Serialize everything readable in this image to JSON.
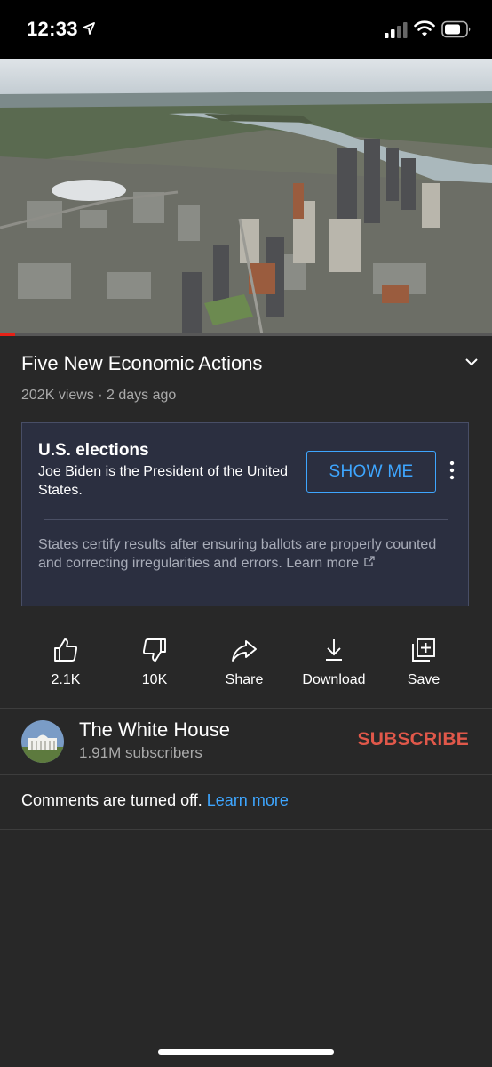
{
  "status_bar": {
    "time": "12:33",
    "icons": [
      "location-arrow-icon",
      "cellular-signal-icon",
      "wifi-icon",
      "battery-icon"
    ]
  },
  "video": {
    "thumbnail": "aerial-city-river-image",
    "progress_fraction": 0.03,
    "progress_color": "#e62117"
  },
  "details": {
    "title": "Five New Economic Actions",
    "meta": "202K views · 2 days ago"
  },
  "info_panel": {
    "heading": "U.S. elections",
    "text": "Joe Biden is the President of the United States.",
    "button_label": "SHOW ME",
    "footnote": "States certify results after ensuring ballots are properly counted and correcting irregularities and errors. Learn more"
  },
  "actions": [
    {
      "icon": "thumbs-up-icon",
      "label": "2.1K"
    },
    {
      "icon": "thumbs-down-icon",
      "label": "10K"
    },
    {
      "icon": "share-icon",
      "label": "Share"
    },
    {
      "icon": "download-icon",
      "label": "Download"
    },
    {
      "icon": "save-playlist-icon",
      "label": "Save"
    }
  ],
  "channel": {
    "name": "The White House",
    "subscribers": "1.91M subscribers",
    "subscribe_label": "SUBSCRIBE"
  },
  "comments": {
    "text": "Comments are turned off.",
    "link": "Learn more"
  },
  "colors": {
    "background": "#282828",
    "accent_blue": "#3ea6ff",
    "subscribe_red": "#e0584a",
    "panel_bg": "#2b2f40"
  }
}
